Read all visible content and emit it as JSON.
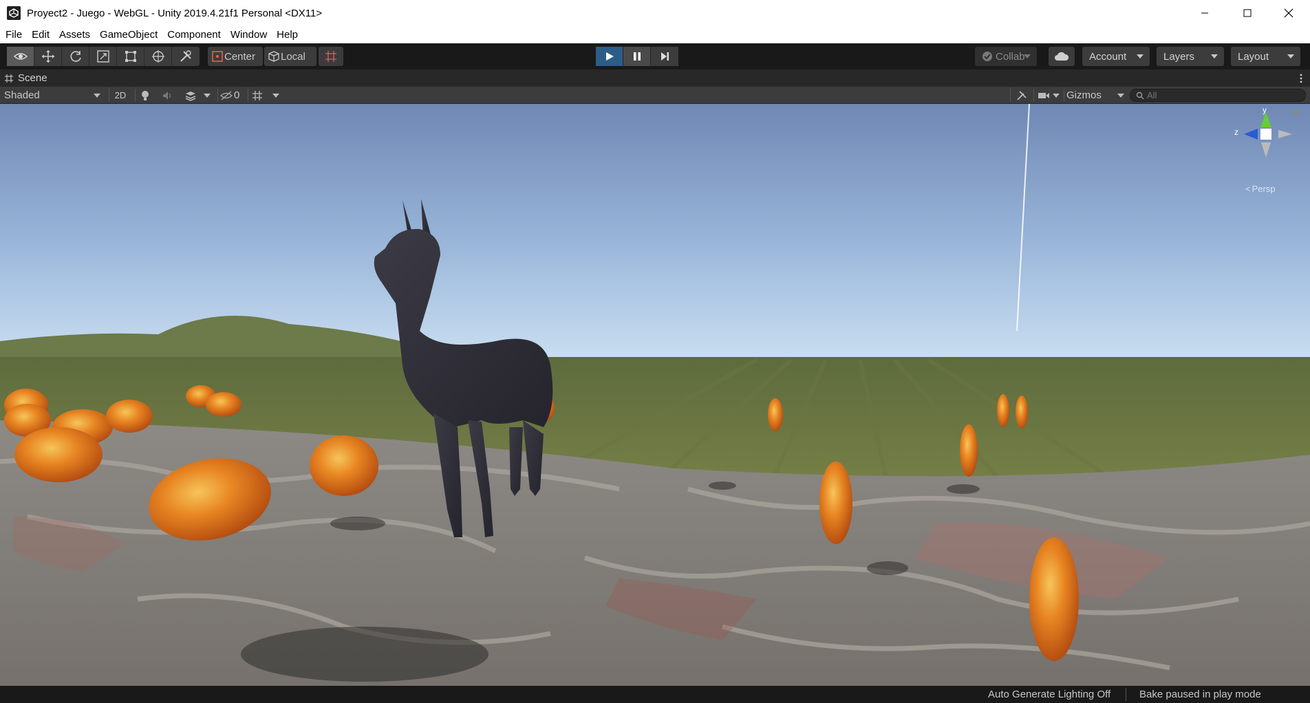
{
  "window": {
    "title": "Proyect2 - Juego - WebGL - Unity 2019.4.21f1 Personal <DX11>"
  },
  "menu": {
    "items": [
      "File",
      "Edit",
      "Assets",
      "GameObject",
      "Component",
      "Window",
      "Help"
    ]
  },
  "toolbar": {
    "tools": [
      "view-tool",
      "move-tool",
      "rotate-tool",
      "scale-tool",
      "rect-tool",
      "transform-tool",
      "custom-tool"
    ],
    "pivot_mode": "Center",
    "pivot_rotation": "Local",
    "collab": "Collab",
    "account": "Account",
    "layers": "Layers",
    "layout": "Layout",
    "play_state": "playing",
    "pause_state": "paused"
  },
  "scene_tab": {
    "label": "Scene"
  },
  "scene_toolbar": {
    "draw_mode": "Shaded",
    "toggle_2d": "2D",
    "hidden_count": "0",
    "gizmos": "Gizmos",
    "search_placeholder": "All"
  },
  "orientation_gizmo": {
    "y_label": "y",
    "z_label": "z",
    "projection": "Persp"
  },
  "status": {
    "lighting": "Auto Generate Lighting Off",
    "bake": "Bake paused in play mode"
  },
  "colors": {
    "accent": "#2c5d87",
    "sky_top": "#7f98bd",
    "ground": "#6f7a45",
    "egg_orange": "#e3701c"
  }
}
